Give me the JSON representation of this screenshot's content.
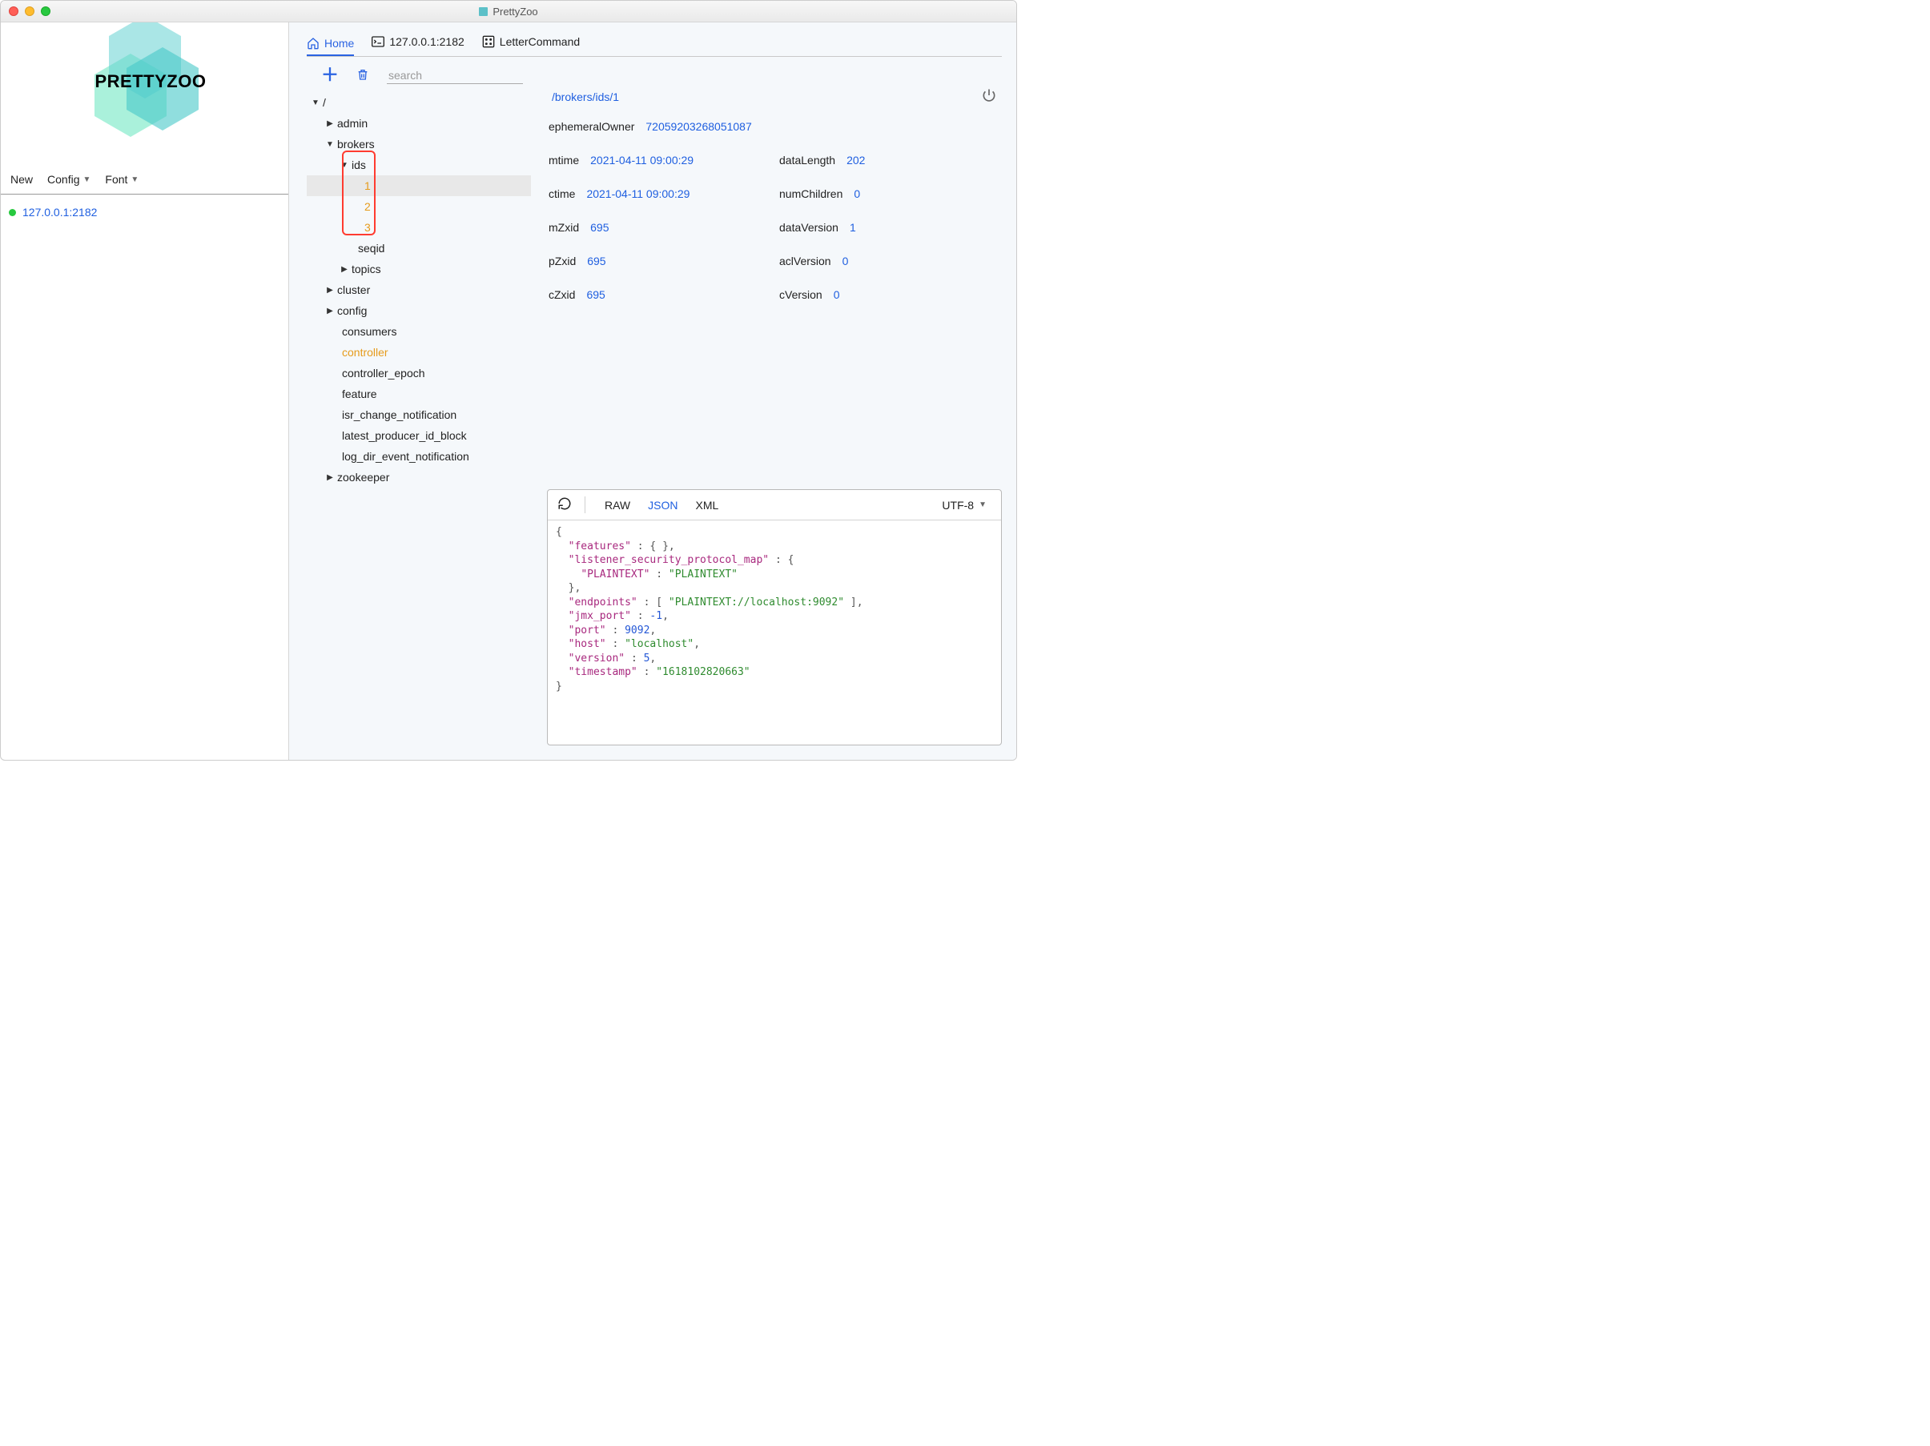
{
  "window": {
    "title": "PrettyZoo"
  },
  "sidebar": {
    "menu": {
      "new": "New",
      "config": "Config",
      "font": "Font"
    },
    "servers": [
      {
        "address": "127.0.0.1:2182",
        "status": "online"
      }
    ]
  },
  "tabs": {
    "home": "Home",
    "terminal": "127.0.0.1:2182",
    "letter": "LetterCommand"
  },
  "toolbar": {
    "search_placeholder": "search"
  },
  "tree": {
    "root": "/",
    "nodes": {
      "admin": "admin",
      "brokers": "brokers",
      "ids": "ids",
      "id1": "1",
      "id2": "2",
      "id3": "3",
      "seqid": "seqid",
      "topics": "topics",
      "cluster": "cluster",
      "config": "config",
      "consumers": "consumers",
      "controller": "controller",
      "controller_epoch": "controller_epoch",
      "feature": "feature",
      "isr_change_notification": "isr_change_notification",
      "latest_producer_id_block": "latest_producer_id_block",
      "log_dir_event_notification": "log_dir_event_notification",
      "zookeeper": "zookeeper"
    }
  },
  "details": {
    "path": "/brokers/ids/1",
    "stats": {
      "ephemeralOwner_k": "ephemeralOwner",
      "ephemeralOwner_v": "72059203268051087",
      "mtime_k": "mtime",
      "mtime_v": "2021-04-11 09:00:29",
      "dataLength_k": "dataLength",
      "dataLength_v": "202",
      "ctime_k": "ctime",
      "ctime_v": "2021-04-11 09:00:29",
      "numChildren_k": "numChildren",
      "numChildren_v": "0",
      "mZxid_k": "mZxid",
      "mZxid_v": "695",
      "dataVersion_k": "dataVersion",
      "dataVersion_v": "1",
      "pZxid_k": "pZxid",
      "pZxid_v": "695",
      "aclVersion_k": "aclVersion",
      "aclVersion_v": "0",
      "cZxid_k": "cZxid",
      "cZxid_v": "695",
      "cVersion_k": "cVersion",
      "cVersion_v": "0"
    }
  },
  "viewer": {
    "raw": "RAW",
    "json": "JSON",
    "xml": "XML",
    "encoding": "UTF-8",
    "code": {
      "features_k": "\"features\"",
      "features_v": "{ }",
      "lspm_k": "\"listener_security_protocol_map\"",
      "plaintext_k": "\"PLAINTEXT\"",
      "plaintext_v": "\"PLAINTEXT\"",
      "endpoints_k": "\"endpoints\"",
      "endpoints_v": "\"PLAINTEXT://localhost:9092\"",
      "jmx_port_k": "\"jmx_port\"",
      "jmx_port_v": "-1",
      "port_k": "\"port\"",
      "port_v": "9092",
      "host_k": "\"host\"",
      "host_v": "\"localhost\"",
      "version_k": "\"version\"",
      "version_v": "5",
      "timestamp_k": "\"timestamp\"",
      "timestamp_v": "\"1618102820663\""
    }
  },
  "logo": {
    "text": "PRETTYZOO"
  }
}
